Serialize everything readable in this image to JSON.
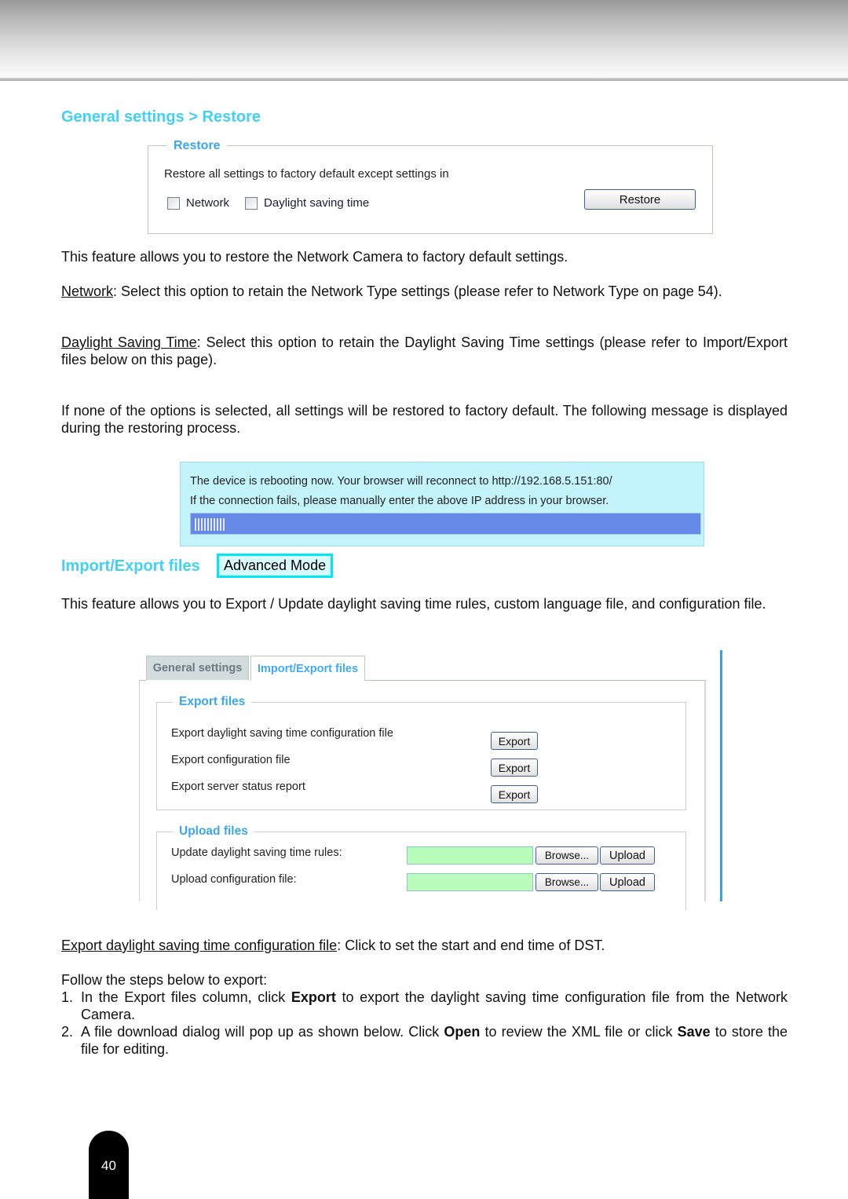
{
  "sections": {
    "restore_title": "General settings > Restore",
    "import_export_title": "Import/Export files",
    "advanced_mode_badge": "Advanced Mode"
  },
  "restore_panel": {
    "legend": "Restore",
    "description": "Restore all settings to factory default except settings in",
    "checkboxes": [
      {
        "label": "Network",
        "checked": false
      },
      {
        "label": "Daylight saving time",
        "checked": false
      }
    ],
    "restore_button": "Restore"
  },
  "paragraphs": {
    "intro": "This feature allows you to restore the Network Camera to factory default settings.",
    "network_term": "Network",
    "network_text": ": Select this option to retain the Network Type settings (please refer to Network Type on page 54).",
    "dst_term": "Daylight Saving Time",
    "dst_text": ": Select this option to retain the Daylight Saving Time settings (please refer to Import/Export files below on this page).",
    "none_selected": "If none of the options is selected, all settings will be restored to factory default.  The following message is displayed during the restoring process.",
    "ie_intro": "This feature allows you to Export / Update daylight saving time rules, custom language file, and configuration file.",
    "export_dst_term": "Export daylight saving time configuration file",
    "export_dst_text": ": Click to set the start and end time of DST.",
    "follow_steps": "Follow the steps below to export:"
  },
  "reboot_message": {
    "line1": "The device is rebooting now. Your browser will reconnect to http://192.168.5.151:80/",
    "line2": "If the connection fails, please manually enter the above IP address in your browser.",
    "progress_ticks": 10
  },
  "import_export_panel": {
    "tabs": [
      {
        "label": "General settings",
        "active": false
      },
      {
        "label": "Import/Export files",
        "active": true
      }
    ],
    "export_files": {
      "legend": "Export files",
      "rows": [
        {
          "label": "Export daylight saving time configuration file",
          "button": "Export"
        },
        {
          "label": "Export configuration file",
          "button": "Export"
        },
        {
          "label": "Export server status report",
          "button": "Export"
        }
      ]
    },
    "upload_files": {
      "legend": "Upload files",
      "rows": [
        {
          "label": "Update daylight saving time rules:",
          "value": "",
          "browse": "Browse...",
          "upload": "Upload"
        },
        {
          "label": "Upload configuration file:",
          "value": "",
          "browse": "Browse...",
          "upload": "Upload"
        }
      ]
    }
  },
  "steps": [
    {
      "num": "1.",
      "pre": "In the Export files column, click ",
      "bold": "Export",
      "post": " to export the daylight saving time configuration file from the Network Camera."
    },
    {
      "num": "2.",
      "pre": "A file download dialog will pop up as shown below. Click ",
      "bold": "Open",
      "mid": " to review the XML file or click ",
      "bold2": "Save",
      "post": " to store the file for editing."
    }
  ],
  "page_number": "40",
  "colors": {
    "heading_cyan": "#40d0f8",
    "legend_blue": "#3aa6f0",
    "reboot_bg": "#c4f4fb",
    "progress_fill": "#6489e6",
    "file_input_green": "#bafcbc",
    "badge_border": "#00e8f8"
  }
}
